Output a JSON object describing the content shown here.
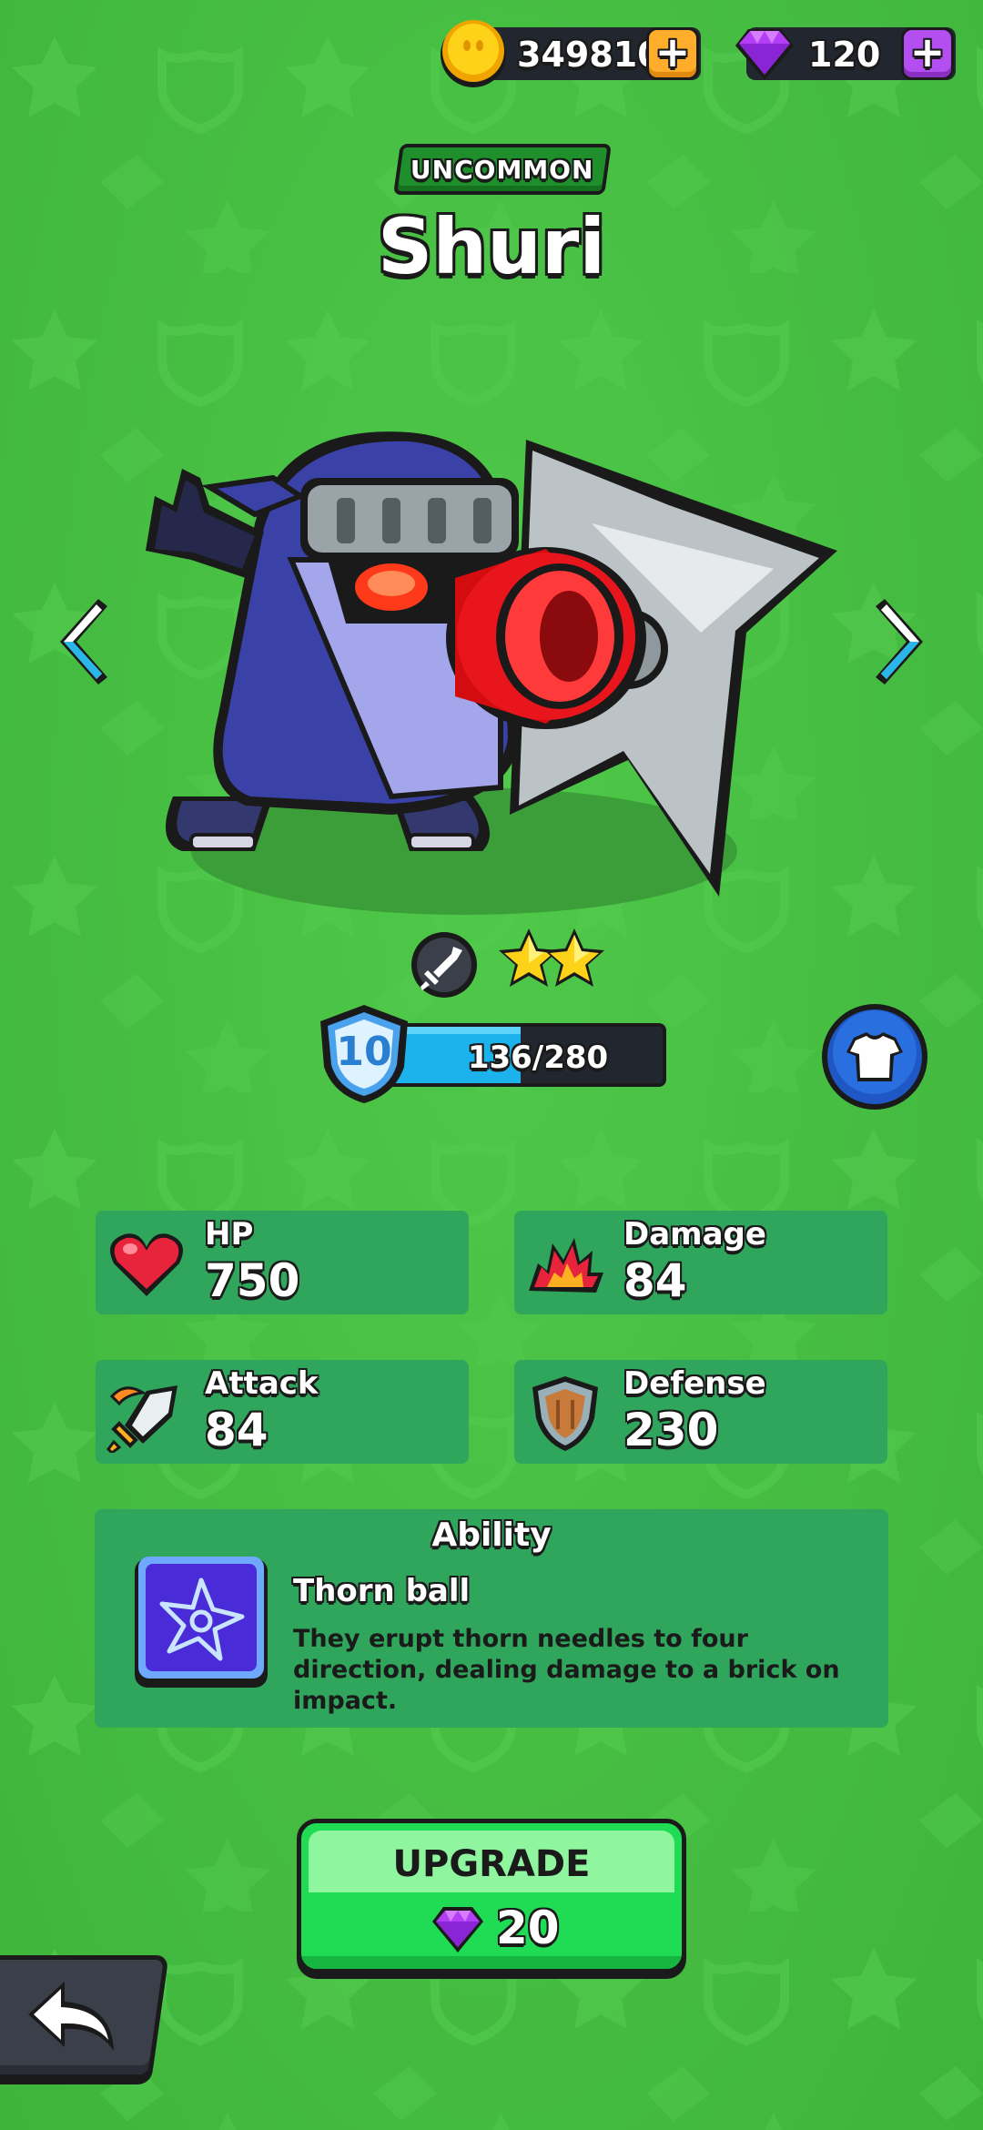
{
  "currency": {
    "coins": "349810",
    "gems": "120",
    "coin_icon": "gold-coin-icon",
    "gem_icon": "purple-gem-icon"
  },
  "hero": {
    "rarity": "UNCOMMON",
    "name": "Shuri",
    "class_icon": "sword-icon",
    "stars": 2,
    "level": "10",
    "xp_text": "136/280",
    "xp_progress": 0.486
  },
  "stats": [
    {
      "label": "HP",
      "value": "750",
      "icon": "heart-icon"
    },
    {
      "label": "Damage",
      "value": "84",
      "icon": "explosion-icon"
    },
    {
      "label": "Attack",
      "value": "84",
      "icon": "flaming-sword-icon"
    },
    {
      "label": "Defense",
      "value": "230",
      "icon": "shield-icon"
    }
  ],
  "ability": {
    "title": "Ability",
    "name": "Thorn ball",
    "description": "They erupt thorn needles to four direction, dealing damage to a brick on impact.",
    "icon": "shuriken-icon"
  },
  "upgrade": {
    "label": "UPGRADE",
    "cost": "20",
    "cost_icon": "purple-gem-icon"
  },
  "colors": {
    "background": "#47bf43",
    "card": "#2fa65c",
    "rarity": "#1e8f2a",
    "xp_fill": "#1cb3ec",
    "upgrade": "#1fdc54"
  }
}
